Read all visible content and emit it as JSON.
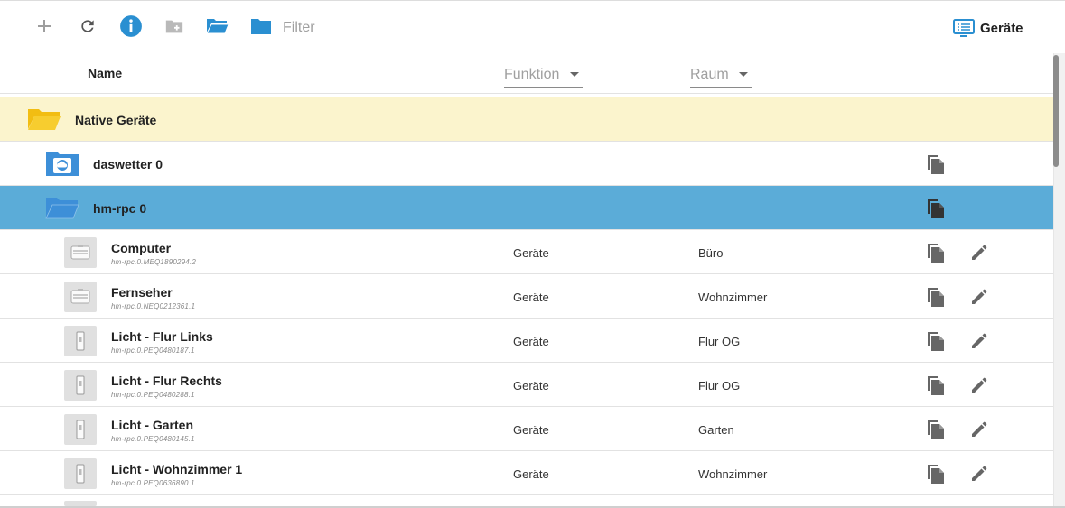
{
  "toolbar": {
    "filter_placeholder": "Filter",
    "view_label": "Geräte"
  },
  "columns": {
    "name": "Name",
    "function": "Funktion",
    "room": "Raum"
  },
  "groups": [
    {
      "title": "Native Geräte",
      "state": "open",
      "color": "#f5c518"
    },
    {
      "title": "daswetter 0",
      "state": "closed",
      "color": "#3d8fd8"
    },
    {
      "title": "hm-rpc 0",
      "state": "open",
      "selected": true,
      "color": "#3d8fd8"
    }
  ],
  "devices": [
    {
      "name": "Computer",
      "id": "hm-rpc.0.MEQ1890294.2",
      "function": "Geräte",
      "room": "Büro",
      "icon": "actuator-box-icon"
    },
    {
      "name": "Fernseher",
      "id": "hm-rpc.0.NEQ0212361.1",
      "function": "Geräte",
      "room": "Wohnzimmer",
      "icon": "actuator-box-icon"
    },
    {
      "name": "Licht - Flur Links",
      "id": "hm-rpc.0.PEQ0480187.1",
      "function": "Geräte",
      "room": "Flur OG",
      "icon": "dimmer-switch-icon"
    },
    {
      "name": "Licht - Flur Rechts",
      "id": "hm-rpc.0.PEQ0480288.1",
      "function": "Geräte",
      "room": "Flur OG",
      "icon": "dimmer-switch-icon"
    },
    {
      "name": "Licht - Garten",
      "id": "hm-rpc.0.PEQ0480145.1",
      "function": "Geräte",
      "room": "Garten",
      "icon": "dimmer-switch-icon"
    },
    {
      "name": "Licht - Wohnzimmer 1",
      "id": "hm-rpc.0.PEQ0636890.1",
      "function": "Geräte",
      "room": "Wohnzimmer",
      "icon": "dimmer-switch-icon"
    }
  ],
  "colors": {
    "accent": "#2a8fd1",
    "selected_row": "#5bacd8",
    "root_group_row": "#fbf4cd"
  }
}
